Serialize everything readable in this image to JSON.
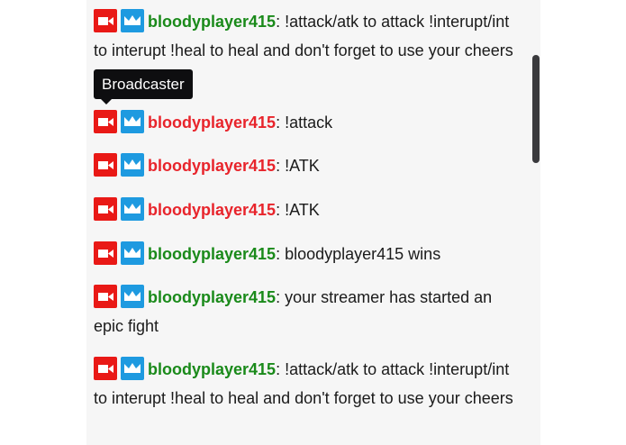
{
  "colors": {
    "broadcaster_badge": "#e91916",
    "prime_badge": "#1e9ae0",
    "username_green": "#1a8a1a",
    "username_red": "#e8242b"
  },
  "badges": {
    "broadcaster_icon": "video-camera-icon",
    "prime_icon": "crown-icon"
  },
  "tooltip": {
    "text": "Broadcaster"
  },
  "messages": [
    {
      "user": "bloodyplayer415",
      "separator": ":",
      "text": " !attack/atk to attack !interupt/int to interupt !heal to heal and don't forget to use your cheers",
      "user_color": "green"
    },
    {
      "user": "bloodyplayer415",
      "separator": ":",
      "text": " !attack",
      "user_color": "red"
    },
    {
      "user": "bloodyplayer415",
      "separator": ":",
      "text": " !ATK",
      "user_color": "red"
    },
    {
      "user": "bloodyplayer415",
      "separator": ":",
      "text": " !ATK",
      "user_color": "red"
    },
    {
      "user": "bloodyplayer415",
      "separator": ":",
      "text": " bloodyplayer415 wins",
      "user_color": "green"
    },
    {
      "user": "bloodyplayer415",
      "separator": ":",
      "text": " your streamer has started an epic fight",
      "user_color": "green"
    },
    {
      "user": "bloodyplayer415",
      "separator": ":",
      "text": " !attack/atk to attack !interupt/int to interupt !heal to heal and don't forget to use your cheers",
      "user_color": "green"
    }
  ]
}
